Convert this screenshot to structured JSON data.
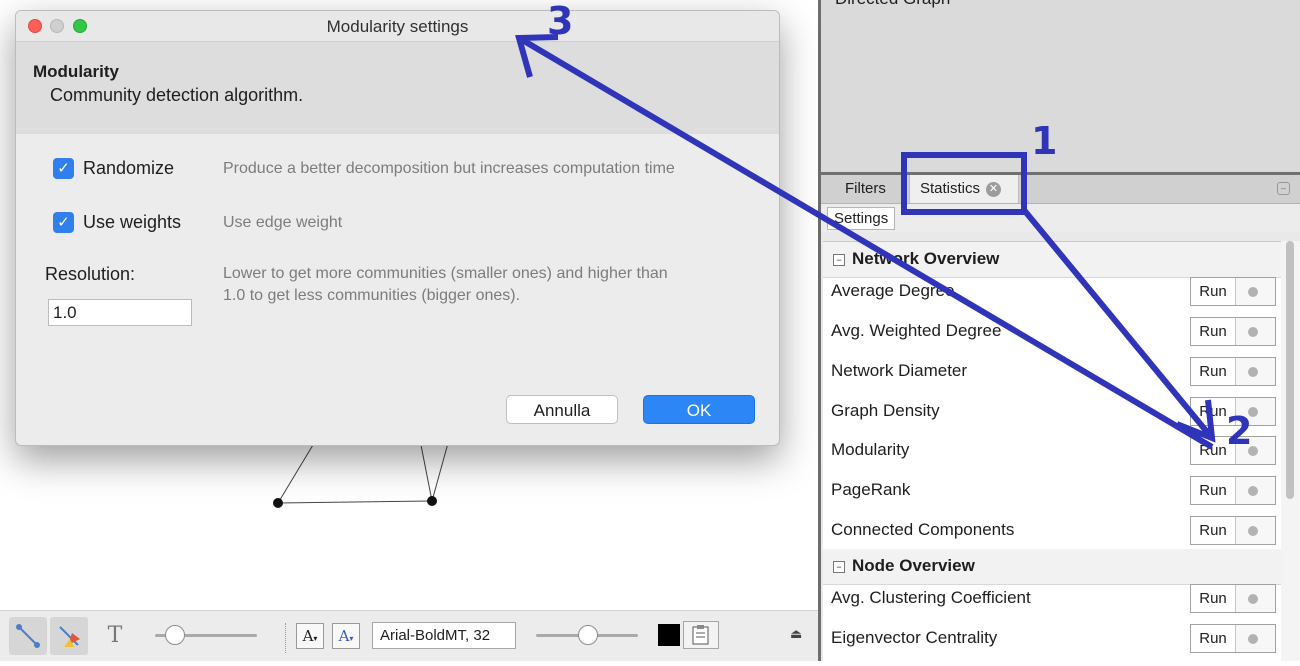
{
  "dialog": {
    "title": "Modularity settings",
    "heading": "Modularity",
    "description": "Community detection algorithm.",
    "options": [
      {
        "label": "Randomize",
        "checked": true,
        "help": "Produce a better decomposition but increases computation time"
      },
      {
        "label": "Use weights",
        "checked": true,
        "help": "Use edge weight"
      }
    ],
    "resolution": {
      "label": "Resolution:",
      "value": "1.0",
      "help_line1": "Lower to get more communities (smaller ones) and higher than",
      "help_line2": "1.0 to get less communities (bigger ones)."
    },
    "cancel_label": "Annulla",
    "ok_label": "OK"
  },
  "right_panel": {
    "context_label": "Directed Graph",
    "tabs": {
      "filters": "Filters",
      "statistics": "Statistics"
    },
    "settings_label": "Settings",
    "run_label": "Run",
    "sections": [
      {
        "title": "Network Overview",
        "items": [
          "Average Degree",
          "Avg. Weighted Degree",
          "Network Diameter",
          "Graph Density",
          "Modularity",
          "PageRank",
          "Connected Components"
        ]
      },
      {
        "title": "Node Overview",
        "items": [
          "Avg. Clustering Coefficient",
          "Eigenvector Centrality"
        ]
      }
    ]
  },
  "toolbar": {
    "font_value": "Arial-BoldMT, 32",
    "font_size_decrease": "A",
    "font_size_increase": "A",
    "text_tool": "T",
    "icons": [
      "edge-tool-icon",
      "color-edges-icon",
      "text-icon",
      "eject-icon",
      "screenshot-icon"
    ],
    "node_size_level": 0.15,
    "label_size_level": 0.5,
    "label_color": "#000000"
  },
  "annotations": {
    "one": "1",
    "two": "2",
    "three": "3",
    "color": "#2f34b8"
  }
}
